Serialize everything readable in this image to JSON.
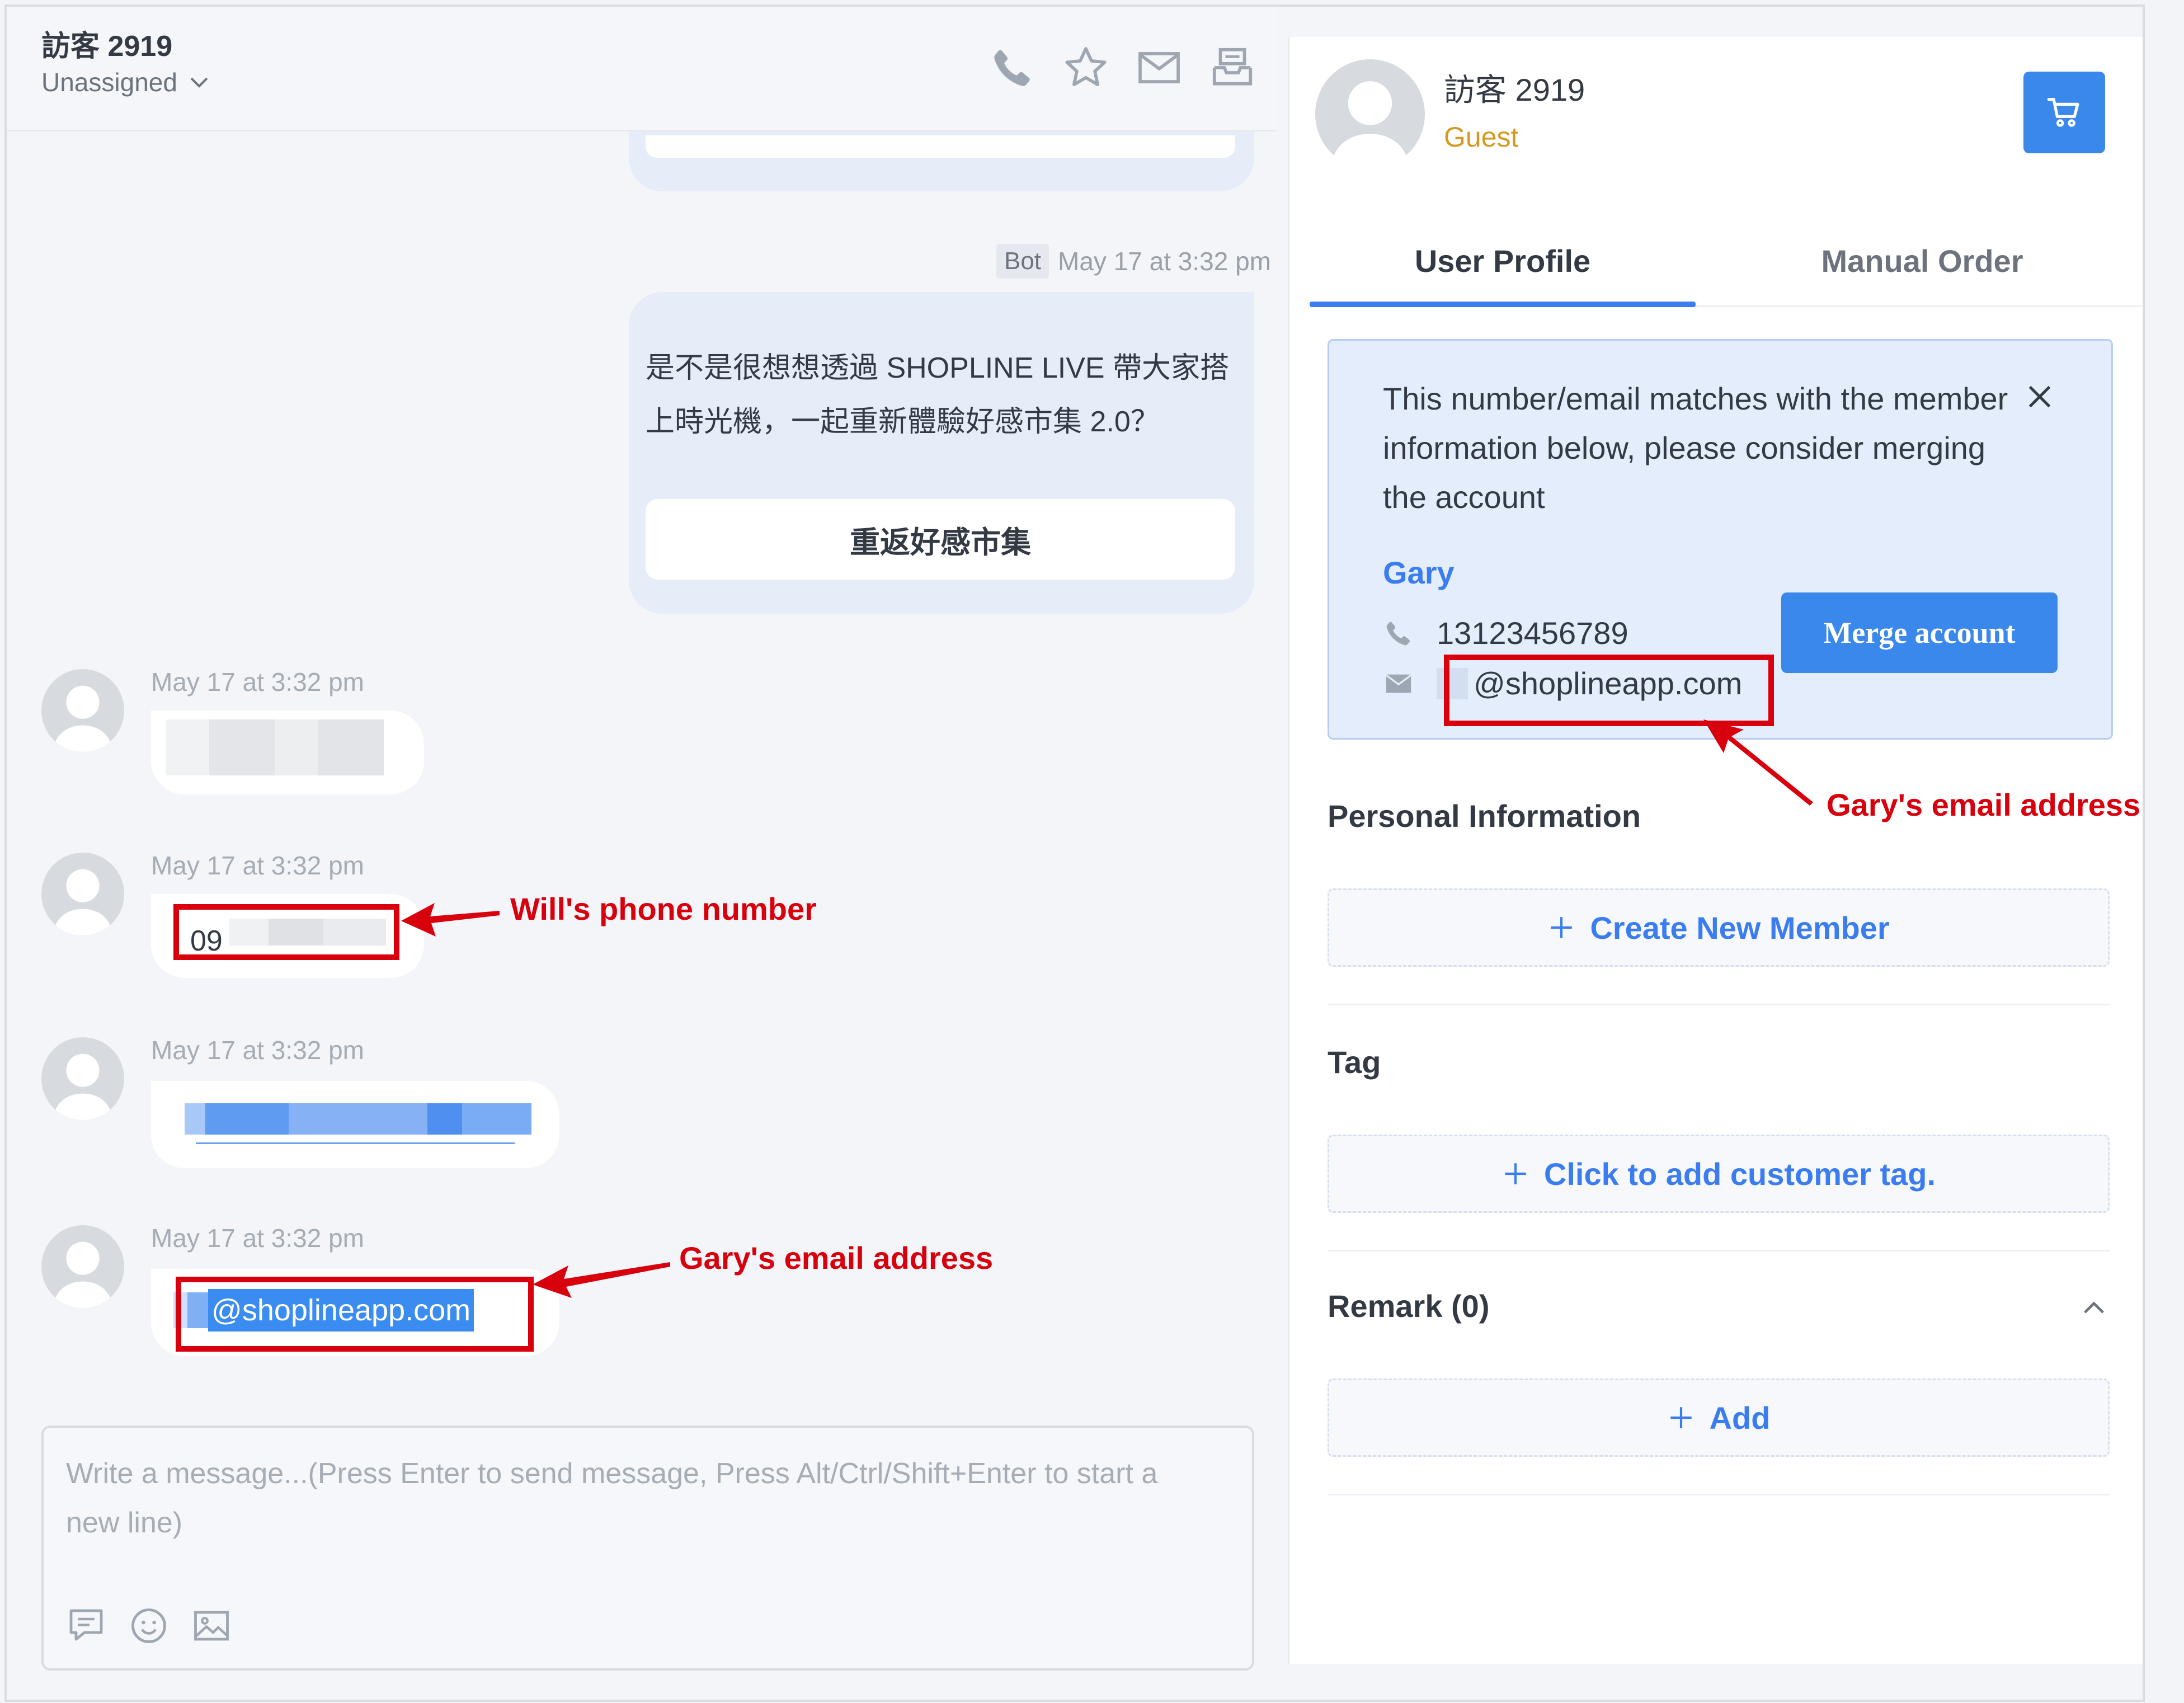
{
  "chat": {
    "title": "訪客 2919",
    "assignee": "Unassigned",
    "header_icons": [
      "phone-icon",
      "star-icon",
      "mail-icon",
      "archive-icon"
    ],
    "bot_label": "Bot",
    "bot_time": "May 17 at 3:32 pm",
    "bot_message": "是不是很想想透過 SHOPLINE LIVE 帶大家搭上時光機，一起重新體驗好感市集 2.0？",
    "bot_button": "重返好感市集",
    "messages": [
      {
        "time": "May 17 at 3:32 pm",
        "text": ""
      },
      {
        "time": "May 17 at 3:32 pm",
        "text": "09"
      },
      {
        "time": "May 17 at 3:32 pm",
        "text": ""
      },
      {
        "time": "May 17 at 3:32 pm",
        "text": "@shoplineapp.com"
      }
    ],
    "composer_placeholder": "Write a message...(Press Enter to send message, Press Alt/Ctrl/Shift+Enter to start a new line)",
    "composer_icons": [
      "template-icon",
      "emoji-icon",
      "image-icon"
    ]
  },
  "annotations": {
    "phone": "Will's phone number",
    "email_chat": "Gary's email address",
    "email_profile": "Gary's email address"
  },
  "profile": {
    "name": "訪客 2919",
    "role": "Guest",
    "tabs": [
      "User Profile",
      "Manual Order"
    ],
    "match_notice": "This number/email matches with the member information below, please consider merging the account",
    "member_name": "Gary",
    "member_phone": "13123456789",
    "member_email": "@shoplineapp.com",
    "merge_label": "Merge account",
    "personal_info_title": "Personal Information",
    "create_member_label": "Create New Member",
    "tag_title": "Tag",
    "add_tag_label": "Click to add customer tag.",
    "remark_title": "Remark (0)",
    "add_remark_label": "Add"
  },
  "colors": {
    "accent": "#3b7df0",
    "guest": "#d49a20",
    "annotation": "#d9000e",
    "selection": "#3b8cf0"
  }
}
